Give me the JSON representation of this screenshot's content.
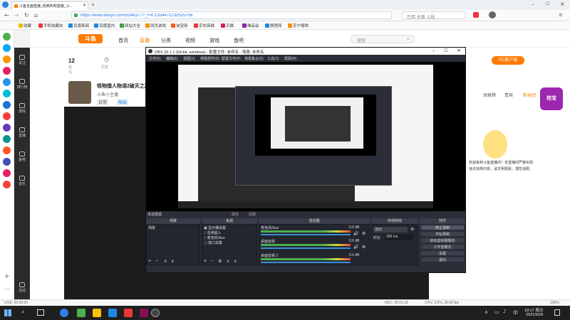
{
  "browser": {
    "tab_title": "斗鱼全面直播_经典所知直播_斗...",
    "new_tab": "+",
    "url": "https://www.douyu.com/5246377?_r=0.13544712325257​09",
    "search_box": "巴西 全面 上线"
  },
  "bookmarks": [
    "收藏",
    "手机收藏夹",
    "百度新闻",
    "百度国内",
    "网站大全",
    "网页游戏",
    "淘宝网",
    "京东商城",
    "天猫",
    "唯品会",
    "携程网",
    "苏宁易购"
  ],
  "douyu": {
    "logo": "斗鱼",
    "nav": [
      "首页",
      "直播",
      "分类",
      "视频",
      "游戏",
      "鱼吧"
    ],
    "search_placeholder": "搜索",
    "follow_count": "12",
    "follow_label": "关注",
    "history_label": "历史",
    "live_title": "怪物猎人物语2破灭之翼",
    "host_name": "斗鱼小主播",
    "tags": [
      "日常",
      "陪玩"
    ],
    "download_btn": "PC客户端",
    "sidebar_items": [
      "关注",
      "排行榜",
      "游戏",
      "直播",
      "鱼吧",
      "音乐",
      "活动"
    ],
    "right_tabs": [
      "贡献榜",
      "贵宾",
      "粉丝团"
    ],
    "right_badge": "抢宝",
    "chat_text": "欢迎来到斗鱼直播间！本直播间严禁出现违法违规内容，请文明观看，理性消费。"
  },
  "obs": {
    "title": "OBS 26.1.1 (64-bit, windows) - 配置文件: 未命名 - 场景: 未命名",
    "menu": [
      "文件(F)",
      "编辑(E)",
      "视图(V)",
      "停靠部件(D)",
      "配置文件(P)",
      "场景集合(S)",
      "工具(T)",
      "帮助(H)"
    ],
    "no_source": "未选择源",
    "props_btn": "属性",
    "filters_btn": "滤镜",
    "docks": {
      "scenes": "场景",
      "sources": "来源",
      "mixer": "混音器",
      "transitions": "转场特效",
      "controls": "控件"
    },
    "scene_items": [
      "场景"
    ],
    "source_items": [
      "显示器采集",
      "音频输入",
      "麦克风/Aux",
      "窗口采集"
    ],
    "mixer_channels": [
      {
        "name": "麦克风/Aux",
        "db": "0.0 dB"
      },
      {
        "name": "桌面音频",
        "db": "0.0 dB"
      },
      {
        "name": "桌面音频 2",
        "db": "0.0 dB"
      }
    ],
    "transition_type": "淡出",
    "duration_label": "时长",
    "duration_value": "300 ms",
    "controls": [
      "停止录制",
      "开始录制",
      "启动虚拟摄像机",
      "工作室模式",
      "设置",
      "退出"
    ],
    "add": "+",
    "remove": "−",
    "up": "∧",
    "down": "∨"
  },
  "status": {
    "live": "LIVE: 00:00:00",
    "rec": "REC: 00:01:18",
    "cpu": "CPU: 3.5%, 30.00 fps",
    "zoom": "100%"
  },
  "taskbar": {
    "time": "19:17",
    "date": "2021/9/26",
    "weekday": "周日",
    "lang": "中"
  },
  "colors": {
    "douyu_orange": "#ff7a00",
    "obs_bg": "#2b2e38",
    "taskbar": "#1f1f1f"
  }
}
